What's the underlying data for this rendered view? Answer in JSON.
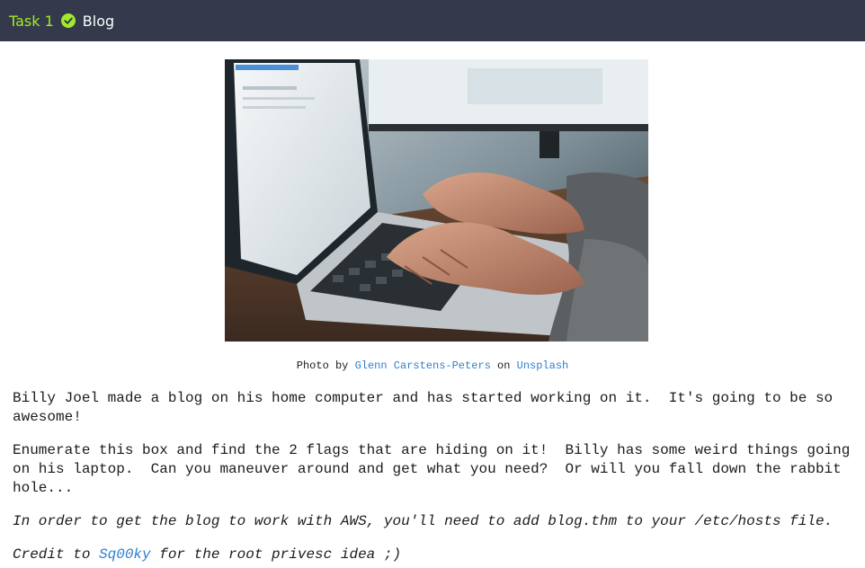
{
  "header": {
    "task_label": "Task 1",
    "task_title": "Blog",
    "status_icon": "check-circle-icon",
    "colors": {
      "bar": "#343a4b",
      "task_label": "#a3ea2a",
      "check": "#a3ea2a"
    }
  },
  "photo": {
    "description_icon": "laptop-photo"
  },
  "caption": {
    "prefix": "Photo by ",
    "author": "Glenn Carstens-Peters",
    "middle": " on ",
    "site": "Unsplash"
  },
  "content": {
    "p1": "Billy Joel made a blog on his home computer and has started working on it.  It's going to be so\nawesome!",
    "p2": "Enumerate this box and find the 2 flags that are hiding on it!  Billy has some weird things going\non his laptop.  Can you maneuver around and get what you need?  Or will you fall down the rabbit\nhole...",
    "p3": "In order to get the blog to work with AWS, you'll need to add blog.thm to your /etc/hosts file.",
    "credit_prefix": "Credit to ",
    "credit_link": "Sq00ky",
    "credit_suffix": " for the root privesc idea ;)"
  },
  "colors": {
    "link": "#2f80d0"
  }
}
